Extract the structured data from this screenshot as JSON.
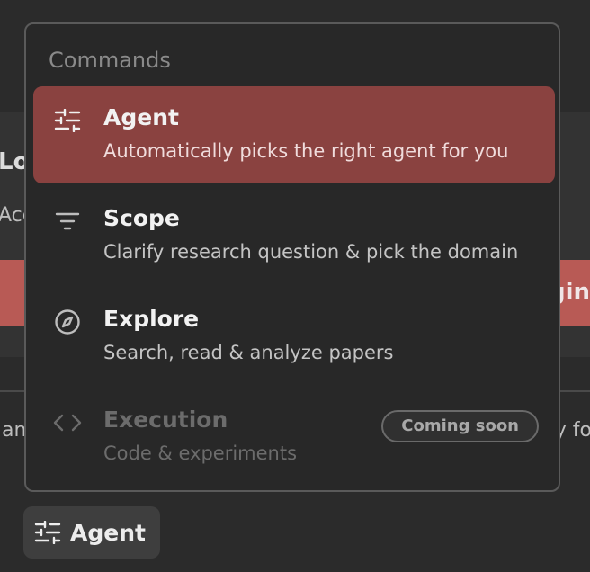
{
  "background": {
    "title_fragment": "Lo",
    "sub_fragment": "Acc",
    "banner_fragment": "gin",
    "line_left_fragment": "an",
    "line_right_fragment": "y fo"
  },
  "popup": {
    "header": "Commands",
    "commands": [
      {
        "label": "Agent",
        "description": "Automatically picks the right agent for you",
        "icon": "sliders-icon",
        "active": true,
        "disabled": false
      },
      {
        "label": "Scope",
        "description": "Clarify research question & pick the domain",
        "icon": "filter-icon",
        "active": false,
        "disabled": false
      },
      {
        "label": "Explore",
        "description": "Search, read & analyze papers",
        "icon": "compass-icon",
        "active": false,
        "disabled": false
      },
      {
        "label": "Execution",
        "description": "Code & experiments",
        "icon": "code-icon",
        "active": false,
        "disabled": true,
        "badge": "Coming soon"
      }
    ]
  },
  "agent_button": {
    "label": "Agent",
    "icon": "sliders-icon"
  },
  "colors": {
    "active_bg": "#8a4240",
    "banner": "#b85a55"
  }
}
